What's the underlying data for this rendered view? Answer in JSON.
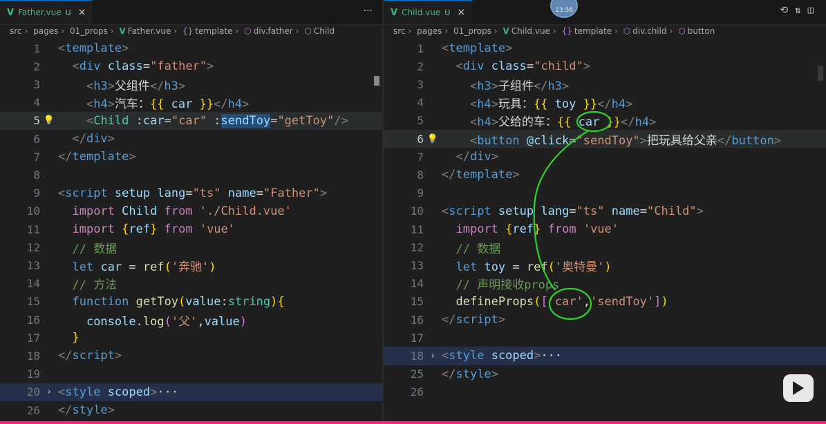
{
  "left": {
    "tab": {
      "icon": "V",
      "label": "Father.vue",
      "status": "U",
      "more": "···"
    },
    "breadcrumb": [
      "src",
      "pages",
      "01_props",
      "Father.vue",
      "template",
      "div.father",
      "Child"
    ],
    "lines": [
      {
        "n": "1"
      },
      {
        "n": "2"
      },
      {
        "n": "3"
      },
      {
        "n": "4"
      },
      {
        "n": "5"
      },
      {
        "n": "6"
      },
      {
        "n": "7"
      },
      {
        "n": "8"
      },
      {
        "n": "9"
      },
      {
        "n": "10"
      },
      {
        "n": "11"
      },
      {
        "n": "12"
      },
      {
        "n": "13"
      },
      {
        "n": "14"
      },
      {
        "n": "15"
      },
      {
        "n": "16"
      },
      {
        "n": "17"
      },
      {
        "n": "18"
      },
      {
        "n": "19"
      },
      {
        "n": "20"
      },
      {
        "n": "26"
      }
    ],
    "code": {
      "l1_a": "<",
      "l1_b": "template",
      "l1_c": ">",
      "l2_a": "<",
      "l2_b": "div",
      "l2_c": "class",
      "l2_d": "=",
      "l2_e": "\"father\"",
      "l2_f": ">",
      "l3_a": "<",
      "l3_b": "h3",
      "l3_c": ">",
      "l3_d": "父组件",
      "l3_e": "</",
      "l3_f": "h3",
      "l3_g": ">",
      "l4_a": "<",
      "l4_b": "h4",
      "l4_c": ">",
      "l4_d": "汽车：",
      "l4_e": "{{",
      "l4_f": "car",
      "l4_g": "}}",
      "l4_h": "</",
      "l4_i": "h4",
      "l4_j": ">",
      "l5_a": "<",
      "l5_b": "Child",
      "l5_c": ":car",
      "l5_d": "=",
      "l5_e": "\"car\"",
      "l5_f": ":",
      "l5_g": "sendToy",
      "l5_h": "=",
      "l5_i": "\"getToy\"",
      "l5_j": "/>",
      "l6_a": "</",
      "l6_b": "div",
      "l6_c": ">",
      "l7_a": "</",
      "l7_b": "template",
      "l7_c": ">",
      "l9_a": "<",
      "l9_b": "script",
      "l9_c": "setup",
      "l9_d": "lang",
      "l9_e": "=",
      "l9_f": "\"ts\"",
      "l9_g": "name",
      "l9_h": "=",
      "l9_i": "\"Father\"",
      "l9_j": ">",
      "l10_a": "import",
      "l10_b": "Child",
      "l10_c": "from",
      "l10_d": "'./Child.vue'",
      "l11_a": "import",
      "l11_b": "{",
      "l11_c": "ref",
      "l11_d": "}",
      "l11_e": "from",
      "l11_f": "'vue'",
      "l12": "// 数据",
      "l13_a": "let",
      "l13_b": "car",
      "l13_c": "=",
      "l13_d": "ref",
      "l13_e": "(",
      "l13_f": "'奔驰'",
      "l13_g": ")",
      "l14": "// 方法",
      "l15_a": "function",
      "l15_b": "getToy",
      "l15_c": "(",
      "l15_d": "value",
      "l15_e": ":",
      "l15_f": "string",
      "l15_g": ")",
      "l15_h": "{",
      "l16_a": "console",
      "l16_b": ".",
      "l16_c": "log",
      "l16_d": "(",
      "l16_e": "'父'",
      "l16_f": ",",
      "l16_g": "value",
      "l16_h": ")",
      "l17": "}",
      "l18_a": "</",
      "l18_b": "script",
      "l18_c": ">",
      "l20_a": "<",
      "l20_b": "style",
      "l20_c": "scoped",
      "l20_d": ">",
      "l20_e": "···",
      "l26_a": "</",
      "l26_b": "style",
      "l26_c": ">"
    }
  },
  "right": {
    "tab": {
      "icon": "V",
      "label": "Child.vue",
      "status": "U",
      "close": "×"
    },
    "avatar_text": "13:56",
    "breadcrumb": [
      "src",
      "pages",
      "01_props",
      "Child.vue",
      "template",
      "div.child",
      "button"
    ],
    "lines": [
      {
        "n": "1"
      },
      {
        "n": "2"
      },
      {
        "n": "3"
      },
      {
        "n": "4"
      },
      {
        "n": "5"
      },
      {
        "n": "6"
      },
      {
        "n": "7"
      },
      {
        "n": "8"
      },
      {
        "n": "9"
      },
      {
        "n": "10"
      },
      {
        "n": "11"
      },
      {
        "n": "12"
      },
      {
        "n": "13"
      },
      {
        "n": "14"
      },
      {
        "n": "15"
      },
      {
        "n": "16"
      },
      {
        "n": "17"
      },
      {
        "n": "18"
      },
      {
        "n": "25"
      },
      {
        "n": "26"
      }
    ],
    "code": {
      "l1_a": "<",
      "l1_b": "template",
      "l1_c": ">",
      "l2_a": "<",
      "l2_b": "div",
      "l2_c": "class",
      "l2_d": "=",
      "l2_e": "\"child\"",
      "l2_f": ">",
      "l3_a": "<",
      "l3_b": "h3",
      "l3_c": ">",
      "l3_d": "子组件",
      "l3_e": "</",
      "l3_f": "h3",
      "l3_g": ">",
      "l4_a": "<",
      "l4_b": "h4",
      "l4_c": ">",
      "l4_d": "玩具：",
      "l4_e": "{{",
      "l4_f": "toy",
      "l4_g": "}}",
      "l4_h": "</",
      "l4_i": "h4",
      "l4_j": ">",
      "l5_a": "<",
      "l5_b": "h4",
      "l5_c": ">",
      "l5_d": "父给的车：",
      "l5_e": "{{",
      "l5_f": "car",
      "l5_g": "}}",
      "l5_h": "</",
      "l5_i": "h4",
      "l5_j": ">",
      "l6_a": "<",
      "l6_b": "button",
      "l6_c": "@click",
      "l6_d": "=",
      "l6_e": "\"sendToy\"",
      "l6_f": ">",
      "l6_g": "把玩具给父亲",
      "l6_h": "</",
      "l6_i": "button",
      "l6_j": ">",
      "l7_a": "</",
      "l7_b": "div",
      "l7_c": ">",
      "l8_a": "</",
      "l8_b": "template",
      "l8_c": ">",
      "l10_a": "<",
      "l10_b": "script",
      "l10_c": "setup",
      "l10_d": "lang",
      "l10_e": "=",
      "l10_f": "\"ts\"",
      "l10_g": "name",
      "l10_h": "=",
      "l10_i": "\"Child\"",
      "l10_j": ">",
      "l11_a": "import",
      "l11_b": "{",
      "l11_c": "ref",
      "l11_d": "}",
      "l11_e": "from",
      "l11_f": "'vue'",
      "l12": "// 数据",
      "l13_a": "let",
      "l13_b": "toy",
      "l13_c": "=",
      "l13_d": "ref",
      "l13_e": "(",
      "l13_f": "'奥特曼'",
      "l13_g": ")",
      "l14": "// 声明接收props",
      "l15_a": "defineProps",
      "l15_b": "(",
      "l15_c": "[",
      "l15_d": "'car'",
      "l15_e": ",",
      "l15_f": "'sendToy'",
      "l15_g": "]",
      "l15_h": ")",
      "l16_a": "</",
      "l16_b": "script",
      "l16_c": ">",
      "l18_a": "<",
      "l18_b": "style",
      "l18_c": "scoped",
      "l18_d": ">",
      "l18_e": "···",
      "l25_a": "</",
      "l25_b": "style",
      "l25_c": ">"
    }
  },
  "colors": {
    "accent": "#0078d4",
    "vue": "#41b883",
    "annotation": "#2ed12e",
    "bottom_bar": "#e0367c"
  }
}
